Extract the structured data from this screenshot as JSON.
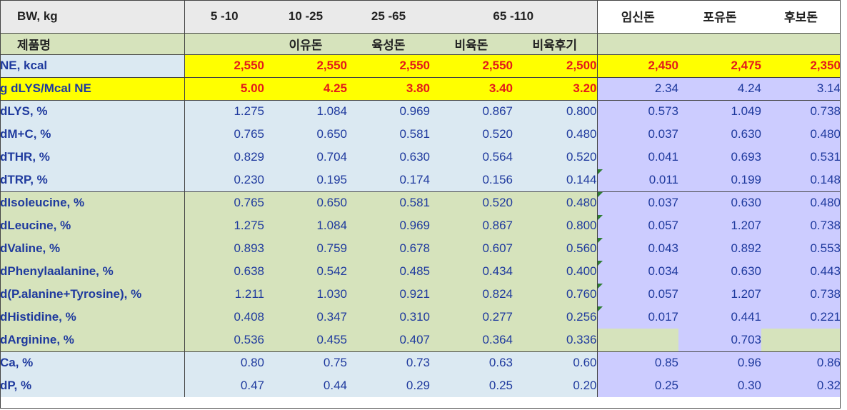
{
  "header": {
    "bw_label": "BW, kg",
    "ranges": [
      "5 -10",
      "10 -25",
      "25 -65",
      "65 -110"
    ],
    "sow_types": [
      "임신돈",
      "포유돈",
      "후보돈"
    ]
  },
  "product_row": {
    "label": "제품명",
    "names": [
      "",
      "이유돈",
      "육성돈",
      "비육돈",
      "비육후기"
    ]
  },
  "rows": [
    {
      "label": "NE, kcal",
      "values": [
        "2,550",
        "2,550",
        "2,550",
        "2,550",
        "2,500",
        "2,450",
        "2,475",
        "2,350"
      ]
    },
    {
      "label": "g dLYS/Mcal NE",
      "values": [
        "5.00",
        "4.25",
        "3.80",
        "3.40",
        "3.20",
        "2.34",
        "4.24",
        "3.14"
      ]
    },
    {
      "label": "dLYS, %",
      "values": [
        "1.275",
        "1.084",
        "0.969",
        "0.867",
        "0.800",
        "0.573",
        "1.049",
        "0.738"
      ]
    },
    {
      "label": "dM+C, %",
      "values": [
        "0.765",
        "0.650",
        "0.581",
        "0.520",
        "0.480",
        "0.037",
        "0.630",
        "0.480"
      ]
    },
    {
      "label": "dTHR, %",
      "values": [
        "0.829",
        "0.704",
        "0.630",
        "0.564",
        "0.520",
        "0.041",
        "0.693",
        "0.531"
      ]
    },
    {
      "label": "dTRP, %",
      "values": [
        "0.230",
        "0.195",
        "0.174",
        "0.156",
        "0.144",
        "0.011",
        "0.199",
        "0.148"
      ]
    },
    {
      "label": "dIsoleucine, %",
      "values": [
        "0.765",
        "0.650",
        "0.581",
        "0.520",
        "0.480",
        "0.037",
        "0.630",
        "0.480"
      ]
    },
    {
      "label": "dLeucine, %",
      "values": [
        "1.275",
        "1.084",
        "0.969",
        "0.867",
        "0.800",
        "0.057",
        "1.207",
        "0.738"
      ]
    },
    {
      "label": "dValine, %",
      "values": [
        "0.893",
        "0.759",
        "0.678",
        "0.607",
        "0.560",
        "0.043",
        "0.892",
        "0.553"
      ]
    },
    {
      "label": "dPhenylaalanine, %",
      "values": [
        "0.638",
        "0.542",
        "0.485",
        "0.434",
        "0.400",
        "0.034",
        "0.630",
        "0.443"
      ]
    },
    {
      "label": "d(P.alanine+Tyrosine), %",
      "values": [
        "1.211",
        "1.030",
        "0.921",
        "0.824",
        "0.760",
        "0.057",
        "1.207",
        "0.738"
      ]
    },
    {
      "label": "dHistidine, %",
      "values": [
        "0.408",
        "0.347",
        "0.310",
        "0.277",
        "0.256",
        "0.017",
        "0.441",
        "0.221"
      ]
    },
    {
      "label": "dArginine, %",
      "values": [
        "0.536",
        "0.455",
        "0.407",
        "0.364",
        "0.336",
        "",
        "0.703",
        ""
      ]
    },
    {
      "label": "Ca, %",
      "values": [
        "0.80",
        "0.75",
        "0.73",
        "0.63",
        "0.60",
        "0.85",
        "0.96",
        "0.86"
      ]
    },
    {
      "label": "dP, %",
      "values": [
        "0.47",
        "0.44",
        "0.29",
        "0.25",
        "0.20",
        "0.25",
        "0.30",
        "0.32"
      ]
    }
  ],
  "colors": {
    "header_bg": "#eaeaea",
    "green_bg": "#d6e3bc",
    "blue_bg": "#dbe9f2",
    "purple_bg": "#ccccff",
    "highlight_yellow": "#ffff00",
    "highlight_red_text": "#e31b1b",
    "label_text": "#1f3a9e",
    "comment_marker": "#2e7d32"
  }
}
